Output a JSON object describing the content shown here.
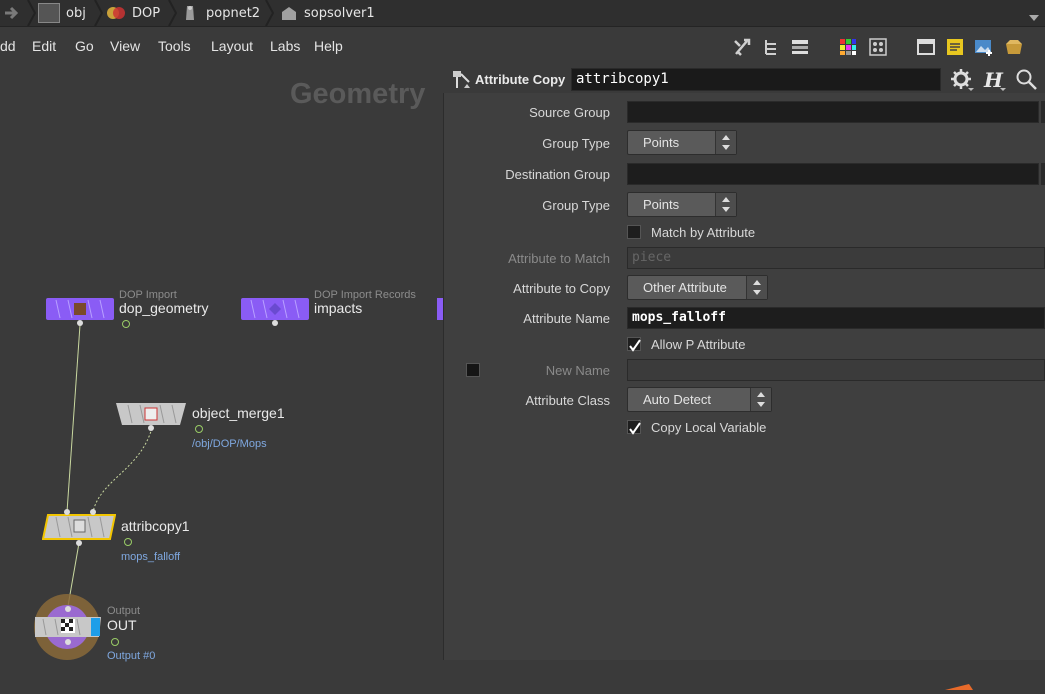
{
  "breadcrumb": {
    "items": [
      {
        "label": "obj",
        "icon": "scene-icon"
      },
      {
        "label": "DOP",
        "icon": "dop-network-icon"
      },
      {
        "label": "popnet2",
        "icon": "pop-network-icon"
      },
      {
        "label": "sopsolver1",
        "icon": "sop-solver-icon"
      }
    ]
  },
  "menu": {
    "items": [
      "dd",
      "Edit",
      "Go",
      "View",
      "Tools",
      "Layout",
      "Labs",
      "Help"
    ]
  },
  "network": {
    "context_title": "Geometry",
    "nodes": {
      "dop_geometry": {
        "type": "DOP Import",
        "name": "dop_geometry"
      },
      "impacts": {
        "type": "DOP Import Records",
        "name": "impacts"
      },
      "object_merge1": {
        "name": "object_merge1",
        "info": "/obj/DOP/Mops"
      },
      "attribcopy1": {
        "name": "attribcopy1",
        "info": "mops_falloff"
      },
      "out": {
        "type": "Output",
        "name": "OUT",
        "info": "Output #0"
      }
    }
  },
  "params": {
    "node_type": "Attribute Copy",
    "node_name": "attribcopy1",
    "source_group_label": "Source Group",
    "source_group_value": "",
    "group_type_label": "Group Type",
    "group_type_value": "Points",
    "destination_group_label": "Destination Group",
    "destination_group_value": "",
    "group_type2_label": "Group Type",
    "group_type2_value": "Points",
    "match_by_attribute_label": "Match by Attribute",
    "attribute_to_match_label": "Attribute to Match",
    "attribute_to_match_value": "piece",
    "attribute_to_copy_label": "Attribute to Copy",
    "attribute_to_copy_value": "Other Attribute",
    "attribute_name_label": "Attribute Name",
    "attribute_name_value": "mops_falloff",
    "allow_p_label": "Allow P Attribute",
    "allow_p_checked": true,
    "new_name_label": "New Name",
    "new_name_value": "",
    "attribute_class_label": "Attribute Class",
    "attribute_class_value": "Auto Detect",
    "copy_local_label": "Copy Local Variable",
    "copy_local_checked": true
  },
  "colors": {
    "dop_node": "#8a5cf5",
    "selected_outline": "#f2c500",
    "info_text": "#7fa8e0",
    "output_ring": "#8a6a3a"
  }
}
